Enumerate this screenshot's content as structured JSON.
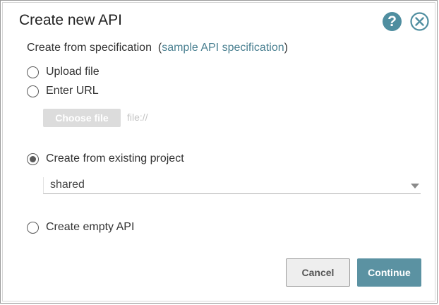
{
  "dialog": {
    "title": "Create new API",
    "help_glyph": "?"
  },
  "spec": {
    "label": "Create from specification",
    "link_open": "(",
    "link_text": "sample API specification",
    "link_close": ")"
  },
  "options": {
    "upload_file": {
      "label": "Upload file",
      "checked": false
    },
    "enter_url": {
      "label": "Enter URL",
      "checked": false
    },
    "existing_project": {
      "label": "Create from existing project",
      "checked": true
    },
    "empty_api": {
      "label": "Create empty API",
      "checked": false
    }
  },
  "file_picker": {
    "button_label": "Choose file",
    "path_placeholder": "file://"
  },
  "project_select": {
    "selected": "shared"
  },
  "actions": {
    "cancel_label": "Cancel",
    "continue_label": "Continue"
  },
  "colors": {
    "accent": "#5b92a2",
    "link": "#4a8091",
    "help_icon": "#4f8ea0"
  },
  "icons": {
    "help": "question-circle-icon",
    "close": "close-circle-icon",
    "dropdown": "caret-down-icon"
  }
}
